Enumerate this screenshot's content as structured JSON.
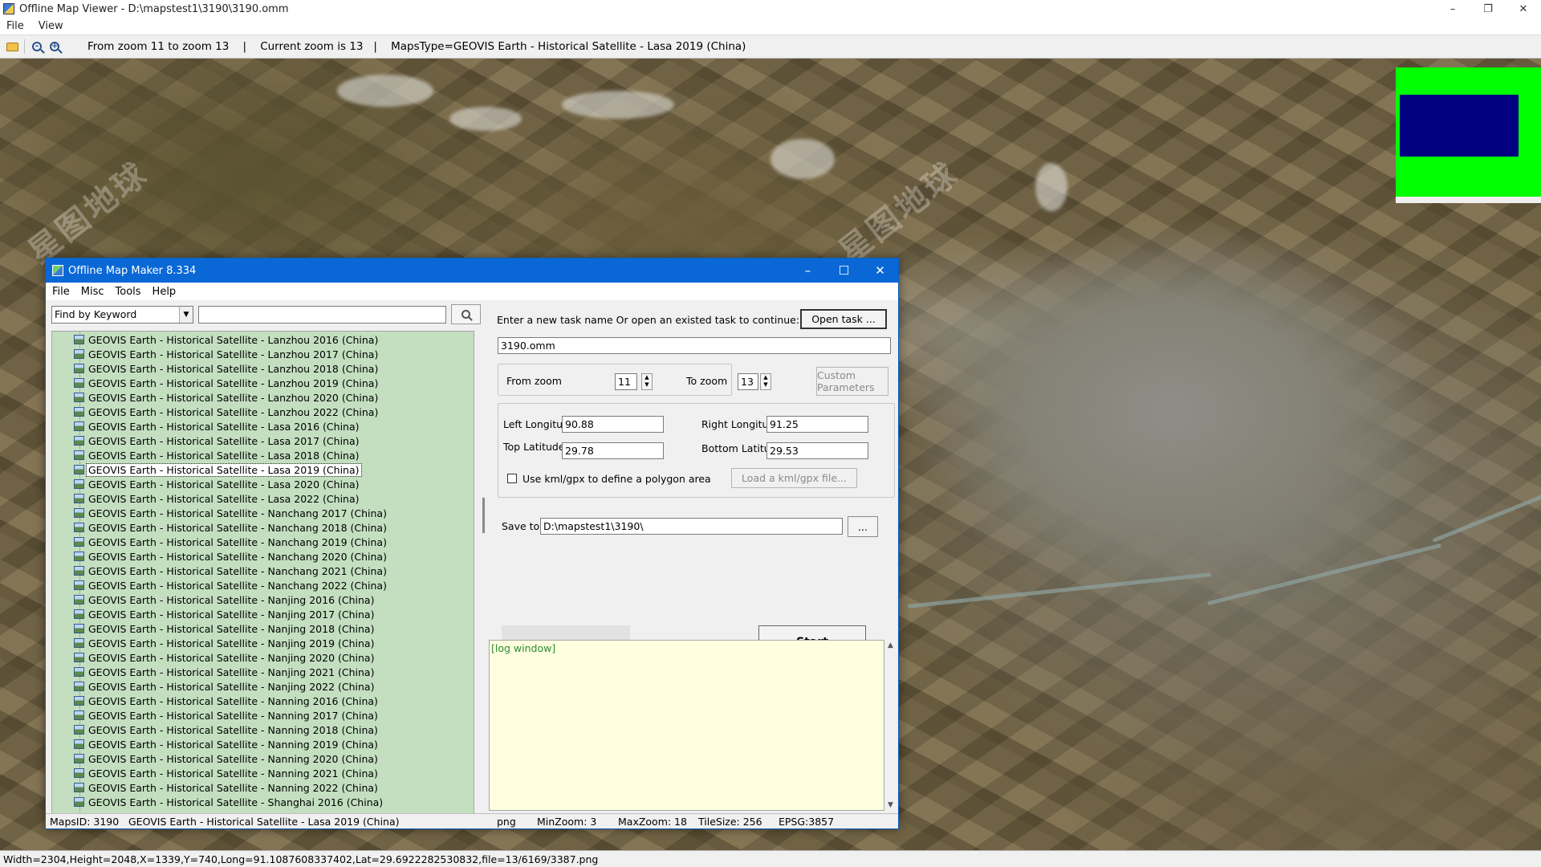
{
  "viewer": {
    "title": "Offline Map Viewer - D:\\mapstest1\\3190\\3190.omm",
    "menu": [
      "File",
      "View"
    ],
    "toolbar_status": "From zoom 11 to zoom 13    |    Current zoom is 13   |    MapsType=GEOVIS Earth - Historical Satellite - Lasa 2019 (China)",
    "statusbar": "Width=2304,Height=2048,X=1339,Y=740,Long=91.1087608337402,Lat=29.6922282530832,file=13/6169/3387.png",
    "watermark_text": "星图地球",
    "minimap_colors": {
      "background": "#00ff00",
      "viewport": "#000080"
    }
  },
  "dialog": {
    "title": "Offline Map Maker 8.334",
    "menu": [
      "File",
      "Misc",
      "Tools",
      "Help"
    ],
    "find_mode": "Find by Keyword",
    "search_value": "",
    "map_list": [
      "GEOVIS Earth - Historical Satellite - Lanzhou 2016 (China)",
      "GEOVIS Earth - Historical Satellite - Lanzhou 2017 (China)",
      "GEOVIS Earth - Historical Satellite - Lanzhou 2018 (China)",
      "GEOVIS Earth - Historical Satellite - Lanzhou 2019 (China)",
      "GEOVIS Earth - Historical Satellite - Lanzhou 2020 (China)",
      "GEOVIS Earth - Historical Satellite - Lanzhou 2022 (China)",
      "GEOVIS Earth - Historical Satellite - Lasa 2016 (China)",
      "GEOVIS Earth - Historical Satellite - Lasa 2017 (China)",
      "GEOVIS Earth - Historical Satellite - Lasa 2018 (China)",
      "GEOVIS Earth - Historical Satellite - Lasa 2019 (China)",
      "GEOVIS Earth - Historical Satellite - Lasa 2020 (China)",
      "GEOVIS Earth - Historical Satellite - Lasa 2022 (China)",
      "GEOVIS Earth - Historical Satellite - Nanchang 2017 (China)",
      "GEOVIS Earth - Historical Satellite - Nanchang 2018 (China)",
      "GEOVIS Earth - Historical Satellite - Nanchang 2019 (China)",
      "GEOVIS Earth - Historical Satellite - Nanchang 2020 (China)",
      "GEOVIS Earth - Historical Satellite - Nanchang 2021 (China)",
      "GEOVIS Earth - Historical Satellite - Nanchang 2022 (China)",
      "GEOVIS Earth - Historical Satellite - Nanjing 2016 (China)",
      "GEOVIS Earth - Historical Satellite - Nanjing 2017 (China)",
      "GEOVIS Earth - Historical Satellite - Nanjing 2018 (China)",
      "GEOVIS Earth - Historical Satellite - Nanjing 2019 (China)",
      "GEOVIS Earth - Historical Satellite - Nanjing 2020 (China)",
      "GEOVIS Earth - Historical Satellite - Nanjing 2021 (China)",
      "GEOVIS Earth - Historical Satellite - Nanjing 2022 (China)",
      "GEOVIS Earth - Historical Satellite - Nanning 2016 (China)",
      "GEOVIS Earth - Historical Satellite - Nanning 2017 (China)",
      "GEOVIS Earth - Historical Satellite - Nanning 2018 (China)",
      "GEOVIS Earth - Historical Satellite - Nanning 2019 (China)",
      "GEOVIS Earth - Historical Satellite - Nanning 2020 (China)",
      "GEOVIS Earth - Historical Satellite - Nanning 2021 (China)",
      "GEOVIS Earth - Historical Satellite - Nanning 2022 (China)",
      "GEOVIS Earth - Historical Satellite - Shanghai 2016 (China)"
    ],
    "selected_item": "GEOVIS Earth - Historical Satellite - Lasa 2019 (China)",
    "task_prompt": "Enter a new task name Or open an existed task to continue:",
    "open_task_label": "Open task ...",
    "task_name": "3190.omm",
    "from_zoom_label": "From zoom",
    "from_zoom": "11",
    "to_zoom_label": "To zoom",
    "to_zoom": "13",
    "custom_params_label": "Custom Parameters",
    "left_lon_label": "Left Longitude",
    "left_lon": "90.88",
    "right_lon_label": "Right Longitude",
    "right_lon": "91.25",
    "top_lat_label": "Top Latitude",
    "top_lat": "29.78",
    "bottom_lat_label": "Bottom Latitude",
    "bottom_lat": "29.53",
    "kml_label": "Use kml/gpx to define a polygon area",
    "kml_checked": false,
    "load_kml_label": "Load a kml/gpx file...",
    "save_to_label": "Save to:",
    "save_to": "D:\\mapstest1\\3190\\",
    "browse_label": "...",
    "start_label": "Start",
    "log_text": "[log window]",
    "status": {
      "maps_id": "MapsID: 3190",
      "map_name": "GEOVIS Earth - Historical Satellite - Lasa 2019 (China)",
      "format": "png",
      "min_zoom": "MinZoom: 3",
      "max_zoom": "MaxZoom: 18",
      "tile_size": "TileSize: 256",
      "epsg": "EPSG:3857"
    }
  }
}
